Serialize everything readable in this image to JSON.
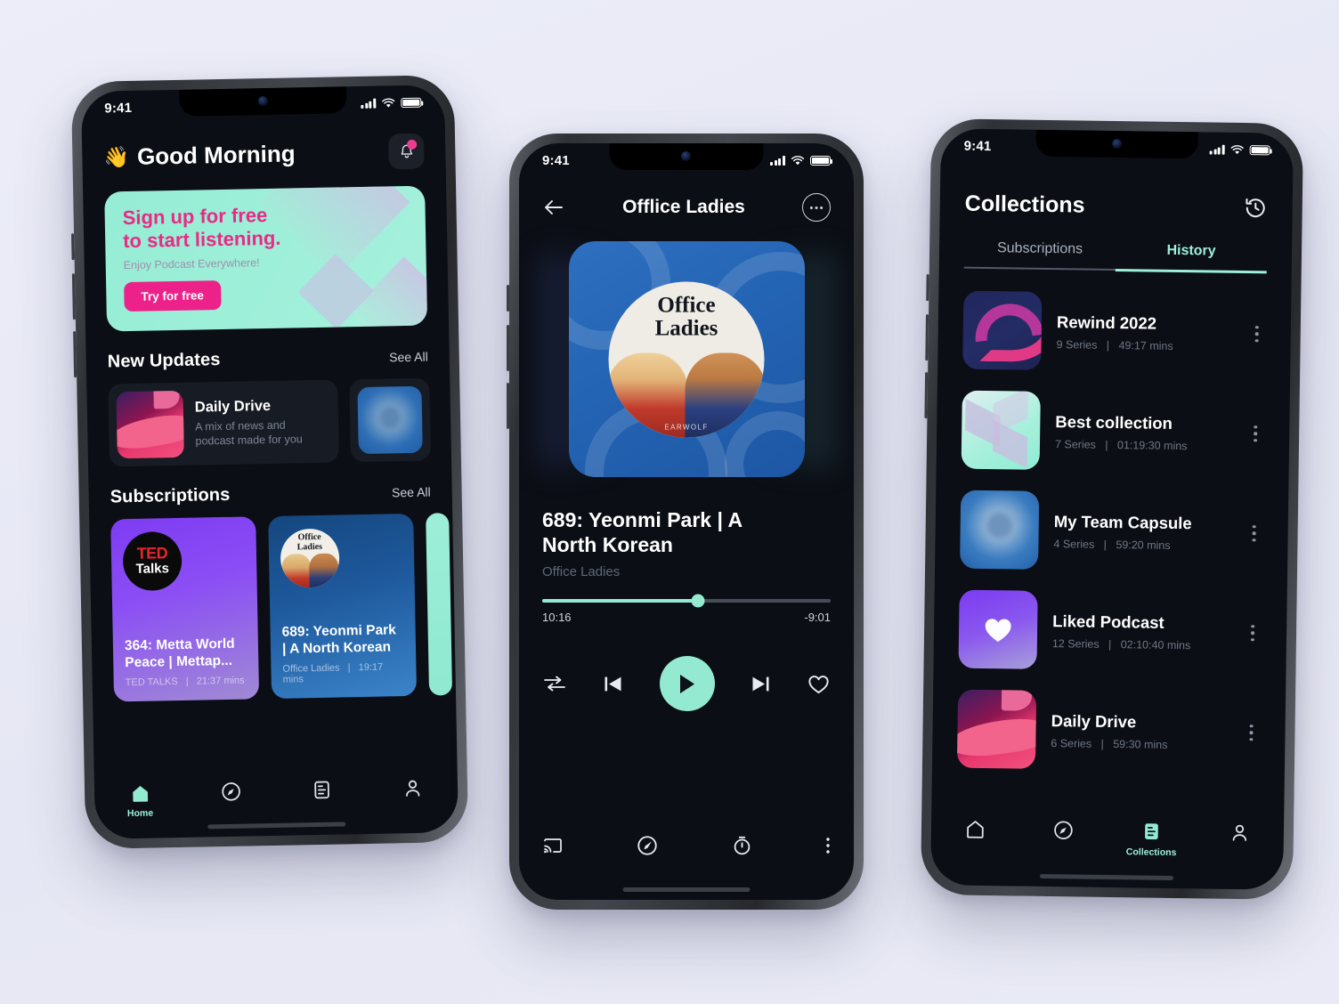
{
  "background_color": "#e9eaf6",
  "accent_mint": "#93ead1",
  "accent_pink": "#ec2189",
  "status_bar": {
    "time": "9:41"
  },
  "phone_home": {
    "greeting_emoji": "👋",
    "greeting": "Good Morning",
    "notification_icon": "bell-icon",
    "promo": {
      "headline_line1": "Sign up for free",
      "headline_line2": "to start listening.",
      "subtext": "Enjoy Podcast Everywhere!",
      "cta": "Try for free"
    },
    "new_updates": {
      "title": "New Updates",
      "see_all": "See All",
      "items": [
        {
          "title": "Daily Drive",
          "desc_line1": "A mix of news and",
          "desc_line2": "podcast made for you",
          "art": "daily-drive-art"
        },
        {
          "art": "capsule-art"
        }
      ]
    },
    "subscriptions": {
      "title": "Subscriptions",
      "see_all": "See All",
      "items": [
        {
          "title_line1": "364: Metta World",
          "title_line2": "Peace | Mettap...",
          "show": "TED TALKS",
          "separator": "|",
          "duration": "21:37 mins",
          "logo": "ted-talks-logo"
        },
        {
          "title_line1": "689: Yeonmi Park",
          "title_line2": "| A North Korean",
          "show": "Office Ladies",
          "separator": "|",
          "duration": "19:17 mins",
          "logo": "office-ladies-logo"
        },
        {
          "partial": true
        }
      ]
    },
    "tabbar": [
      {
        "icon": "home-icon",
        "label": "Home",
        "active": true
      },
      {
        "icon": "compass-icon",
        "label": "",
        "active": false
      },
      {
        "icon": "collections-icon",
        "label": "",
        "active": false
      },
      {
        "icon": "profile-icon",
        "label": "",
        "active": false
      }
    ]
  },
  "phone_player": {
    "back_icon": "arrow-left-icon",
    "title": "Offlice Ladies",
    "more_icon": "more-horizontal-icon",
    "cover": {
      "line1": "Office",
      "line2": "Ladies",
      "network": "EARWOLF"
    },
    "episode_title_line1": "689: Yeonmi Park | A",
    "episode_title_line2": "North Korean",
    "show_name": "Office Ladies",
    "progress_percent": 54,
    "elapsed": "10:16",
    "remaining": "-9:01",
    "controls": [
      {
        "icon": "shuffle-icon"
      },
      {
        "icon": "previous-icon"
      },
      {
        "icon": "play-icon"
      },
      {
        "icon": "next-icon"
      },
      {
        "icon": "heart-icon"
      }
    ],
    "bottom_controls": [
      {
        "icon": "cast-icon"
      },
      {
        "icon": "speed-icon"
      },
      {
        "icon": "sleep-timer-icon"
      },
      {
        "icon": "more-vertical-icon"
      }
    ]
  },
  "phone_collections": {
    "title": "Collections",
    "history_icon": "history-icon",
    "tabs": [
      {
        "label": "Subscriptions",
        "active": false
      },
      {
        "label": "History",
        "active": true
      }
    ],
    "items": [
      {
        "title": "Rewind 2022",
        "series": "9 Series",
        "separator": "|",
        "duration": "49:17 mins",
        "art": "rewind-art"
      },
      {
        "title": "Best collection",
        "series": "7 Series",
        "separator": "|",
        "duration": "01:19:30 mins",
        "art": "cubes-art"
      },
      {
        "title": "My Team Capsule",
        "series": "4 Series",
        "separator": "|",
        "duration": "59:20 mins",
        "art": "capsule-art"
      },
      {
        "title": "Liked Podcast",
        "series": "12 Series",
        "separator": "|",
        "duration": "02:10:40 mins",
        "art": "liked-art"
      },
      {
        "title": "Daily Drive",
        "series": "6 Series",
        "separator": "|",
        "duration": "59:30 mins",
        "art": "daily-drive-art"
      }
    ],
    "tabbar": [
      {
        "icon": "home-icon",
        "label": "",
        "active": false
      },
      {
        "icon": "compass-icon",
        "label": "",
        "active": false
      },
      {
        "icon": "collections-icon",
        "label": "Collections",
        "active": true
      },
      {
        "icon": "profile-icon",
        "label": "",
        "active": false
      }
    ]
  }
}
